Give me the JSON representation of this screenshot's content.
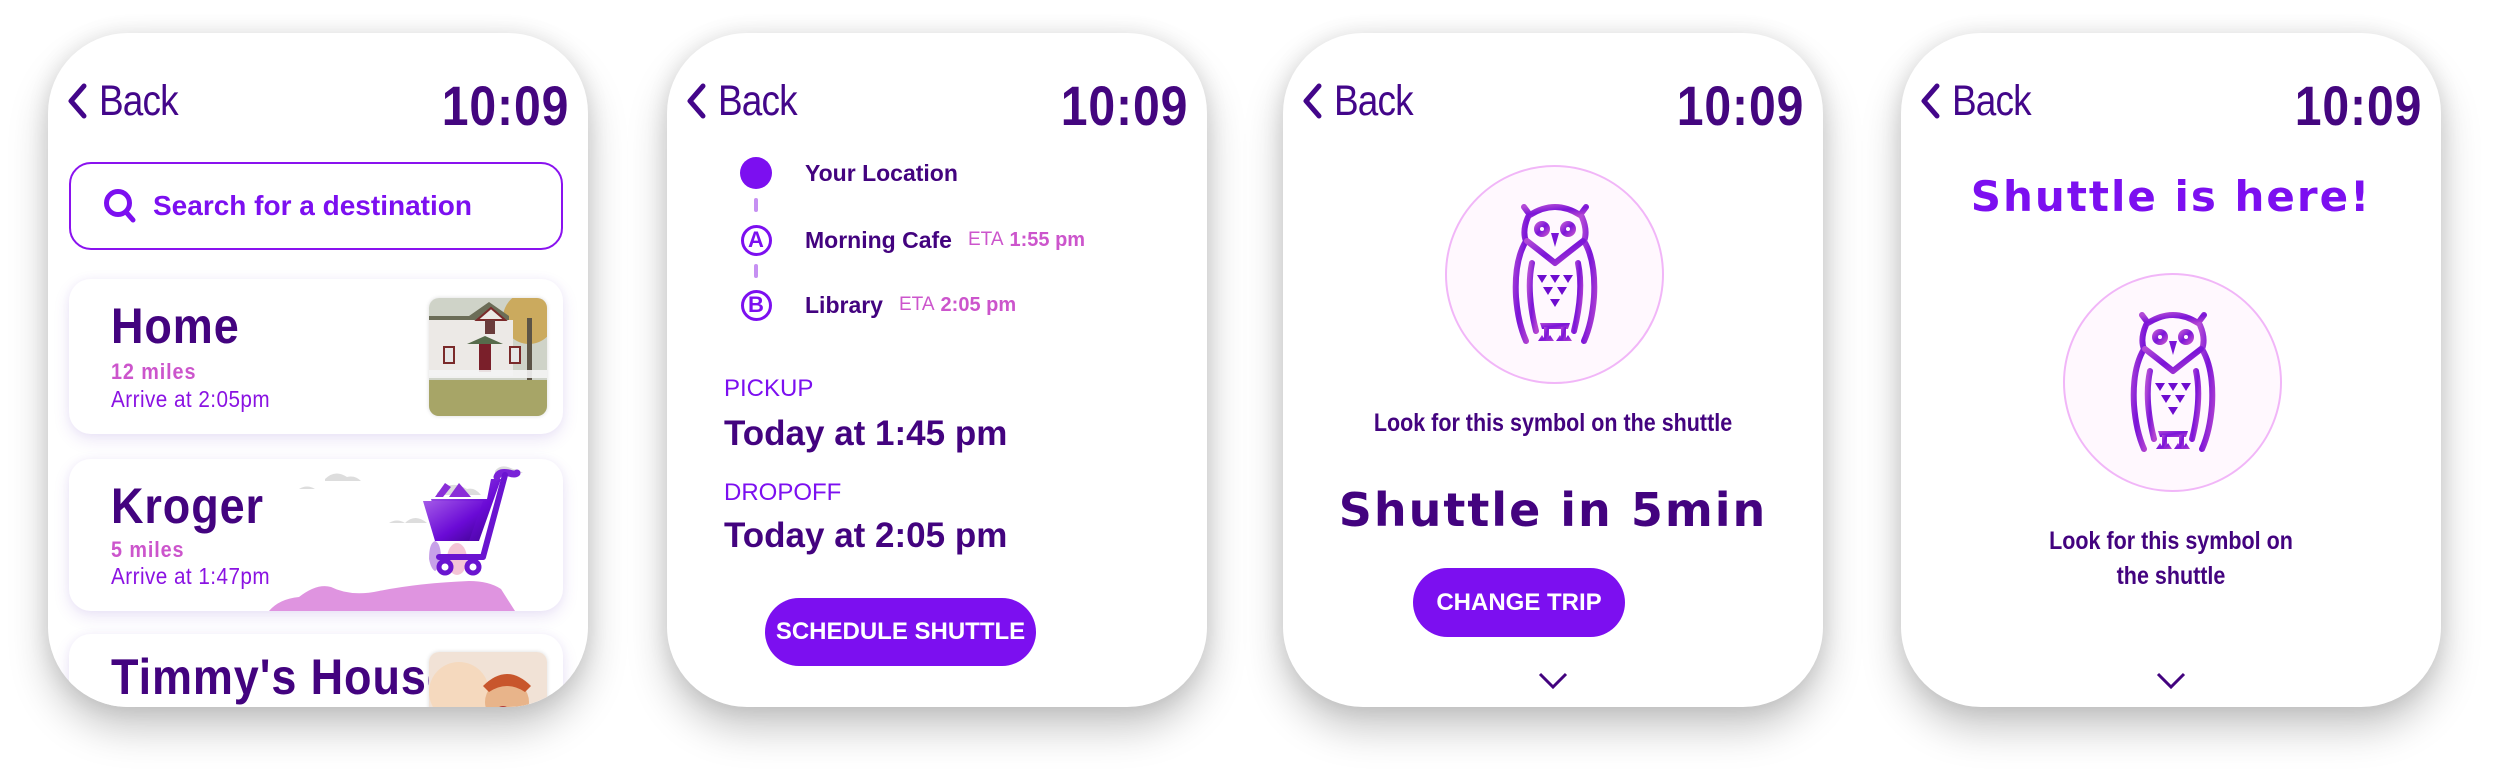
{
  "colors": {
    "primary": "#7c0ff0",
    "dark": "#43037f",
    "accent_pink": "#cc55cc",
    "ring": "#f1b6f8"
  },
  "common": {
    "back_label": "Back",
    "time": "10:09",
    "back_icon": "chevron-left-icon"
  },
  "screen_destinations": {
    "search": {
      "icon": "search-icon",
      "placeholder": "Search for a destination"
    },
    "destinations": [
      {
        "name": "Home",
        "distance": "12 miles",
        "arrival": "Arrive at 2:05pm",
        "image": "house-photo"
      },
      {
        "name": "Kroger",
        "distance": "5 miles",
        "arrival": "Arrive at 1:47pm",
        "image": "shopping-cart-illustration"
      },
      {
        "name": "Timmy's House",
        "image": "child-photo"
      }
    ]
  },
  "screen_trip": {
    "route": [
      {
        "marker": "dot",
        "name": "Your Location"
      },
      {
        "marker": "A",
        "name": "Morning Cafe",
        "eta_label": "ETA",
        "eta": "1:55 pm"
      },
      {
        "marker": "B",
        "name": "Library",
        "eta_label": "ETA",
        "eta": "2:05 pm"
      }
    ],
    "pickup_label": "PICKUP",
    "pickup_value": "Today at 1:45 pm",
    "dropoff_label": "DROPOFF",
    "dropoff_value": "Today at 2:05 pm",
    "action_button": "SCHEDULE SHUTTLE"
  },
  "screen_waiting": {
    "symbol": "owl-icon",
    "hint": "Look for this symbol on the shuttle",
    "status": "Shuttle in 5min",
    "action_button": "CHANGE TRIP",
    "more_icon": "chevron-down-icon"
  },
  "screen_arrived": {
    "status": "Shuttle is here!",
    "symbol": "owl-icon",
    "hint_line1": "Look for this symbol on",
    "hint_line2": "the shuttle",
    "more_icon": "chevron-down-icon"
  }
}
